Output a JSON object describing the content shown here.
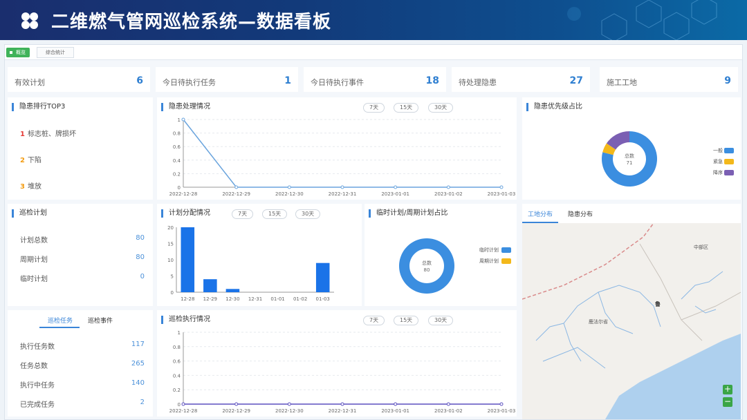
{
  "header": {
    "title": "二维燃气管网巡检系统—数据看板",
    "logo_icon": "clover-icon"
  },
  "tabs": {
    "overview": "概览",
    "stats": "综合统计"
  },
  "stats": [
    {
      "label": "有效计划",
      "value": "6"
    },
    {
      "label": "今日待执行任务",
      "value": "1"
    },
    {
      "label": "今日待执行事件",
      "value": "18"
    },
    {
      "label": "待处理隐患",
      "value": "27"
    },
    {
      "label": "施工工地",
      "value": "9"
    }
  ],
  "hazard_rank": {
    "title": "隐患排行TOP3",
    "items": [
      {
        "rank": "1",
        "text": "标志桩、牌损坏"
      },
      {
        "rank": "2",
        "text": "下陷"
      },
      {
        "rank": "3",
        "text": "堆放"
      }
    ]
  },
  "inspection_plan": {
    "title": "巡检计划",
    "rows": [
      {
        "label": "计划总数",
        "value": "80"
      },
      {
        "label": "周期计划",
        "value": "80"
      },
      {
        "label": "临时计划",
        "value": "0"
      }
    ]
  },
  "task_panel": {
    "tab_active": "巡检任务",
    "tab_other": "巡检事件",
    "rows": [
      {
        "label": "执行任务数",
        "value": "117"
      },
      {
        "label": "任务总数",
        "value": "265"
      },
      {
        "label": "执行中任务",
        "value": "140"
      },
      {
        "label": "已完成任务",
        "value": "2"
      }
    ]
  },
  "range_buttons": [
    "7天",
    "15天",
    "30天"
  ],
  "map": {
    "tab_active": "工地分布",
    "tab_other": "隐患分布",
    "place1": "中部区",
    "place2": "鲁",
    "place3": "鹿法尔省",
    "zoom_in": "+",
    "zoom_out": "−"
  },
  "chart_data": [
    {
      "type": "line",
      "title": "隐患处理情况",
      "x": [
        "2022-12-28",
        "2022-12-29",
        "2022-12-30",
        "2022-12-31",
        "2023-01-01",
        "2023-01-02",
        "2023-01-03"
      ],
      "y": [
        1,
        0,
        0,
        0,
        0,
        0,
        0
      ],
      "ylim": [
        0,
        1
      ],
      "yticks": [
        "0",
        "0.2",
        "0.4",
        "0.6",
        "0.8",
        "1"
      ],
      "color": "#6aa4dd"
    },
    {
      "type": "pie",
      "title": "隐患优先级占比",
      "center_label": "总数",
      "center_value": "71",
      "slices": [
        {
          "name": "一般",
          "value": 56,
          "color": "#3b8ee0"
        },
        {
          "name": "紧急",
          "value": 4,
          "color": "#f3b81a"
        },
        {
          "name": "降序",
          "value": 11,
          "color": "#7b5fb3"
        }
      ]
    },
    {
      "type": "bar",
      "title": "计划分配情况",
      "categories": [
        "12-28",
        "12-29",
        "12-30",
        "12-31",
        "01-01",
        "01-02",
        "01-03"
      ],
      "values": [
        20,
        4,
        1,
        0,
        0,
        0,
        9
      ],
      "ylim": [
        0,
        20
      ],
      "yticks": [
        "0",
        "5",
        "10",
        "15",
        "20"
      ],
      "color": "#1a73e8"
    },
    {
      "type": "pie",
      "title": "临时计划/周期计划占比",
      "center_label": "总数",
      "center_value": "80",
      "slices": [
        {
          "name": "临时计划",
          "value": 80,
          "color": "#3b8ee0"
        },
        {
          "name": "周期计划",
          "value": 0,
          "color": "#f3b81a"
        }
      ]
    },
    {
      "type": "line",
      "title": "巡检执行情况",
      "x": [
        "2022-12-28",
        "2022-12-29",
        "2022-12-30",
        "2022-12-31",
        "2023-01-01",
        "2023-01-02",
        "2023-01-03"
      ],
      "y": [
        0,
        0,
        0,
        0,
        0,
        0,
        0
      ],
      "ylim": [
        0,
        1
      ],
      "yticks": [
        "0",
        "0.2",
        "0.4",
        "0.6",
        "0.8",
        "1"
      ],
      "color": "#5b4fbf"
    }
  ]
}
